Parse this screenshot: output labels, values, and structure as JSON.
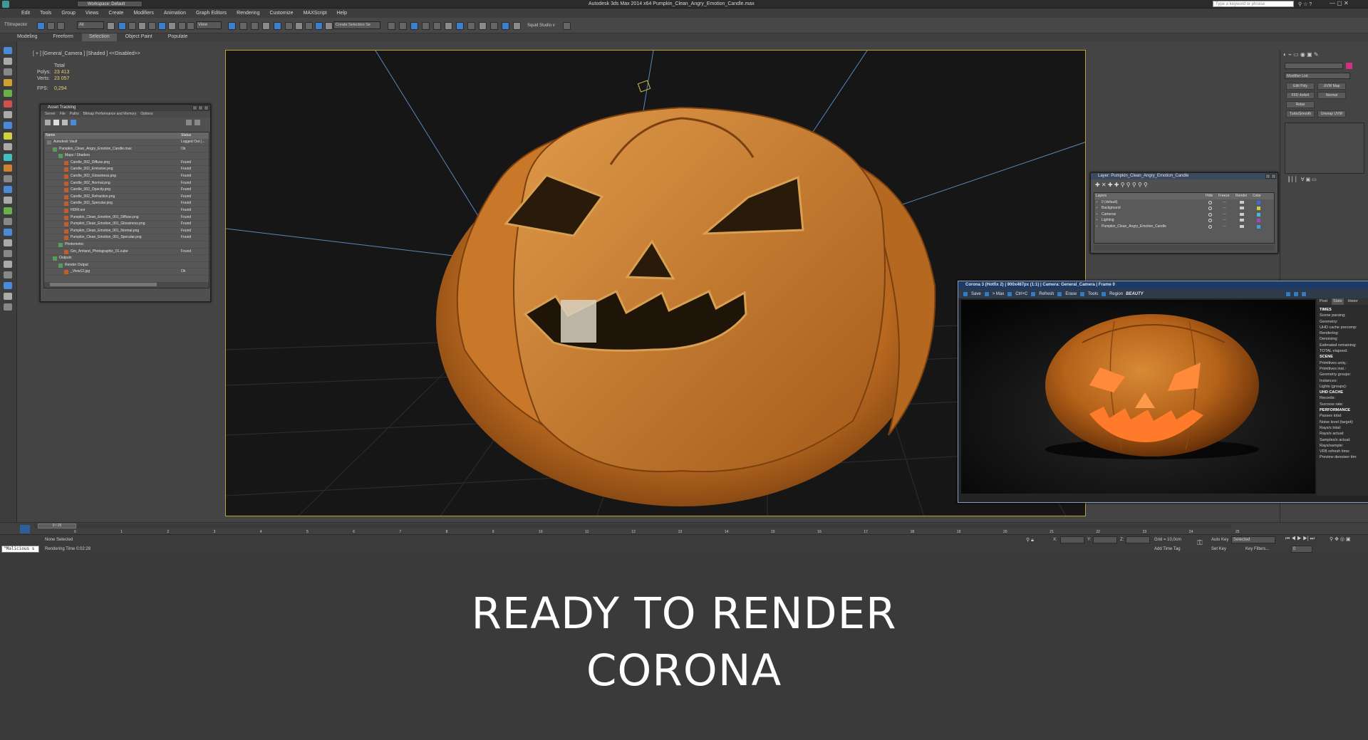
{
  "window": {
    "title": "Autodesk 3ds Max 2014 x64    Pumpkin_Clean_Angry_Emotion_Candle.max",
    "workspace": "Workspace: Default",
    "search_placeholder": "Type a keyword or phrase"
  },
  "menu": [
    "Edit",
    "Tools",
    "Group",
    "Views",
    "Create",
    "Modifiers",
    "Animation",
    "Graph Editors",
    "Rendering",
    "Customize",
    "MAXScript",
    "Help"
  ],
  "toolbar": {
    "selection_filter": "All",
    "view_dropdown": "View",
    "named_selection": "Create Selection Se",
    "squid": "Squid Studio v",
    "ts_inspector": "TSInspector"
  },
  "ribbon": [
    "Modeling",
    "Freeform",
    "Selection",
    "Object Paint",
    "Populate"
  ],
  "viewport": {
    "label": "[ + ] [General_Camera ] [Shaded ] <<Disabled>>",
    "stats_header": "Total",
    "polys_label": "Polys:",
    "polys": "23 413",
    "verts_label": "Verts:",
    "verts": "23 057",
    "fps_label": "FPS:",
    "fps": "0,294"
  },
  "asset_tracking": {
    "title": "Asset Tracking",
    "menu": [
      "Server",
      "File",
      "Paths",
      "Bitmap Performance and Memory",
      "Options"
    ],
    "col_name": "Name",
    "col_status": "Status",
    "rows": [
      {
        "name": "Autodesk Vault",
        "status": "Logged Out (...",
        "indent": 0
      },
      {
        "name": "Pumpkin_Clean_Angry_Emotion_Candle.max",
        "status": "Ok",
        "indent": 1
      },
      {
        "name": "Maps / Shaders",
        "status": "",
        "indent": 2
      },
      {
        "name": "Candle_002_Diffuse.png",
        "status": "Found",
        "indent": 3
      },
      {
        "name": "Candle_002_Emissive.png",
        "status": "Found",
        "indent": 3
      },
      {
        "name": "Candle_002_Glossiness.png",
        "status": "Found",
        "indent": 3
      },
      {
        "name": "Candle_002_Normal.png",
        "status": "Found",
        "indent": 3
      },
      {
        "name": "Candle_002_Opacity.png",
        "status": "Found",
        "indent": 3
      },
      {
        "name": "Candle_002_Refraction.png",
        "status": "Found",
        "indent": 3
      },
      {
        "name": "Candle_002_Specular.png",
        "status": "Found",
        "indent": 3
      },
      {
        "name": "HDRI.exr",
        "status": "Found",
        "indent": 3
      },
      {
        "name": "Pumpkin_Clean_Emotion_001_Diffuse.png",
        "status": "Found",
        "indent": 3
      },
      {
        "name": "Pumpkin_Clean_Emotion_001_Glossiness.png",
        "status": "Found",
        "indent": 3
      },
      {
        "name": "Pumpkin_Clean_Emotion_001_Normal.png",
        "status": "Found",
        "indent": 3
      },
      {
        "name": "Pumpkin_Clean_Emotion_001_Specular.png",
        "status": "Found",
        "indent": 3
      },
      {
        "name": "Photometric",
        "status": "",
        "indent": 2
      },
      {
        "name": "Gm_Amland_Photographic_01.cube",
        "status": "Found",
        "indent": 3
      },
      {
        "name": "Outputs",
        "status": "",
        "indent": 1
      },
      {
        "name": "Render Output",
        "status": "",
        "indent": 2
      },
      {
        "name": "_View12.jpg",
        "status": "Ok",
        "indent": 3
      }
    ]
  },
  "layers": {
    "title": "Layer: Pumpkin_Clean_Angry_Emotion_Candle",
    "headers": {
      "layers": "Layers",
      "hide": "Hide",
      "freeze": "Freeze",
      "render": "Render",
      "color": "Color"
    },
    "rows": [
      {
        "name": "0 (default)",
        "color": "#3a6ee0"
      },
      {
        "name": "Background",
        "color": "#c8d040"
      },
      {
        "name": "Cameras",
        "color": "#40c0d8"
      },
      {
        "name": "Lighting",
        "color": "#b040c0"
      },
      {
        "name": "Pumpkin_Clean_Angry_Emotion_Candle",
        "color": "#40a0e0"
      }
    ]
  },
  "vfb": {
    "title": "Corona 3 (Hotfix 2) | 900x487px (1:1) | Camera: General_Camera | Frame 0",
    "buttons": [
      "Save",
      "> Max",
      "Ctrl+C",
      "Refresh",
      "Erase",
      "Tools",
      "Region"
    ],
    "channel": "BEAUTY",
    "tabs": [
      "Post",
      "Stats",
      "Histor"
    ],
    "stats": [
      {
        "t": "TIMES",
        "h": true
      },
      {
        "t": "Scene parsing:"
      },
      {
        "t": "Geometry:"
      },
      {
        "t": "UHD cache precomp:"
      },
      {
        "t": "Rendering:"
      },
      {
        "t": "Denoising:"
      },
      {
        "t": "Estimated remaining:"
      },
      {
        "t": "TOTAL elapsed:"
      },
      {
        "t": "SCENE",
        "h": true
      },
      {
        "t": "Primitives uniq.:"
      },
      {
        "t": "Primitives inst.:"
      },
      {
        "t": "Geometry groups:"
      },
      {
        "t": "Instances:"
      },
      {
        "t": "Lights (groups):"
      },
      {
        "t": "UHD CACHE",
        "h": true
      },
      {
        "t": "Records:"
      },
      {
        "t": "Success rate:"
      },
      {
        "t": "PERFORMANCE",
        "h": true
      },
      {
        "t": "Passes total:"
      },
      {
        "t": "Noise level (target):"
      },
      {
        "t": "Rays/s total:"
      },
      {
        "t": "Rays/s actual:"
      },
      {
        "t": "Samples/s actual:"
      },
      {
        "t": "Rays/sample:"
      },
      {
        "t": "VFB refresh time:"
      },
      {
        "t": "Preview denoiser tim:"
      }
    ]
  },
  "command_panel": {
    "modifier_list": "Modifier List",
    "buttons": [
      "Edit Poly",
      "UVW Map",
      "FFD 4x4x4",
      "Normal",
      "Relax",
      "TurboSmooth",
      "Unwrap UVW"
    ]
  },
  "timeline": {
    "frame": "0 / 25",
    "ticks": [
      "0",
      "1",
      "2",
      "3",
      "4",
      "5",
      "6",
      "7",
      "8",
      "9",
      "10",
      "11",
      "12",
      "13",
      "14",
      "15",
      "16",
      "17",
      "18",
      "19",
      "20",
      "21",
      "22",
      "23",
      "24",
      "25"
    ]
  },
  "status": {
    "selection": "None Selected",
    "render_time": "Rendering Time  0:02:28",
    "maxscript": "\"Malicious s",
    "x_label": "X:",
    "y_label": "Y:",
    "z_label": "Z:",
    "grid": "Grid = 10,0cm",
    "add_time_tag": "Add Time Tag",
    "auto_key": "Auto Key",
    "set_key": "Set Key",
    "selected": "Selected",
    "key_filters": "Key Filters...",
    "frame_field": "0"
  },
  "caption": {
    "line1": "READY TO RENDER",
    "line2": "CORONA"
  }
}
